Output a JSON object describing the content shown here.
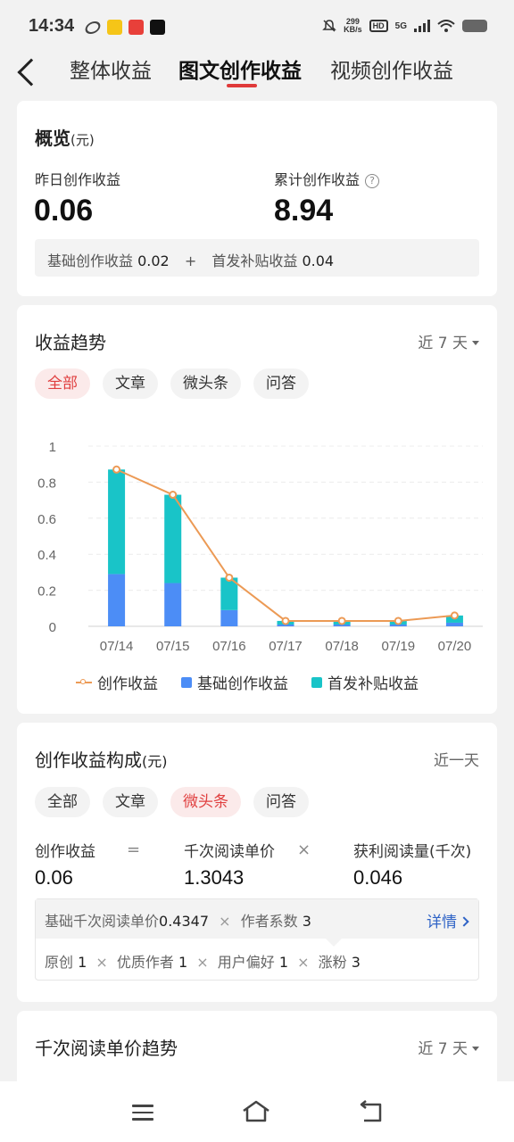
{
  "status_bar": {
    "time": "14:34",
    "net_speed_value": "299",
    "net_speed_unit": "KB/s",
    "hd_label": "HD",
    "network": "5G"
  },
  "nav": {
    "tabs": [
      {
        "label": "整体收益",
        "active": false
      },
      {
        "label": "图文创作收益",
        "active": true
      },
      {
        "label": "视频创作收益",
        "active": false
      }
    ]
  },
  "overview": {
    "title": "概览",
    "unit": "(元)",
    "yesterday_label": "昨日创作收益",
    "yesterday_value": "0.06",
    "total_label": "累计创作收益",
    "total_value": "8.94",
    "help_icon": "?",
    "base_label": "基础创作收益",
    "base_value": "0.02",
    "plus": "+",
    "bonus_label": "首发补贴收益",
    "bonus_value": "0.04"
  },
  "trend": {
    "title": "收益趋势",
    "range": "近 7 天",
    "chips": [
      {
        "label": "全部",
        "active": true
      },
      {
        "label": "文章",
        "active": false
      },
      {
        "label": "微头条",
        "active": false
      },
      {
        "label": "问答",
        "active": false
      }
    ],
    "legend": {
      "line": "创作收益",
      "base": "基础创作收益",
      "bonus": "首发补贴收益"
    }
  },
  "chart_data": {
    "type": "bar",
    "categories": [
      "07/14",
      "07/15",
      "07/16",
      "07/17",
      "07/18",
      "07/19",
      "07/20"
    ],
    "series": [
      {
        "name": "基础创作收益",
        "type": "bar",
        "stack": "total",
        "color": "#4c8df6",
        "values": [
          0.29,
          0.24,
          0.09,
          0.01,
          0.01,
          0.01,
          0.02
        ]
      },
      {
        "name": "首发补贴收益",
        "type": "bar",
        "stack": "total",
        "color": "#19c4c8",
        "values": [
          0.58,
          0.49,
          0.18,
          0.02,
          0.02,
          0.02,
          0.04
        ]
      },
      {
        "name": "创作收益",
        "type": "line",
        "color": "#ec9a55",
        "values": [
          0.87,
          0.73,
          0.27,
          0.03,
          0.03,
          0.03,
          0.06
        ]
      }
    ],
    "yticks": [
      "0",
      "0.2",
      "0.4",
      "0.6",
      "0.8",
      "1"
    ],
    "ylim": [
      0,
      1
    ],
    "grid": true,
    "legend_position": "bottom"
  },
  "composition": {
    "title": "创作收益构成",
    "unit": "(元)",
    "range": "近一天",
    "chips": [
      {
        "label": "全部",
        "active": false
      },
      {
        "label": "文章",
        "active": false
      },
      {
        "label": "微头条",
        "active": true
      },
      {
        "label": "问答",
        "active": false
      }
    ],
    "formula": {
      "income_label": "创作收益",
      "income_value": "0.06",
      "equals": "=",
      "price_label": "千次阅读单价",
      "price_value": "1.3043",
      "times": "×",
      "reads_label": "获利阅读量(千次)",
      "reads_value": "0.046"
    },
    "detail": {
      "base_price_label": "基础千次阅读单价",
      "base_price_value": "0.4347",
      "times": "×",
      "coef_label": "作者系数",
      "coef_value": "3",
      "link": "详情",
      "original_label": "原创",
      "original_value": "1",
      "quality_label": "优质作者",
      "quality_value": "1",
      "pref_label": "用户偏好",
      "pref_value": "1",
      "fans_label": "涨粉",
      "fans_value": "3"
    }
  },
  "price_trend": {
    "title": "千次阅读单价趋势",
    "range": "近 7 天"
  }
}
